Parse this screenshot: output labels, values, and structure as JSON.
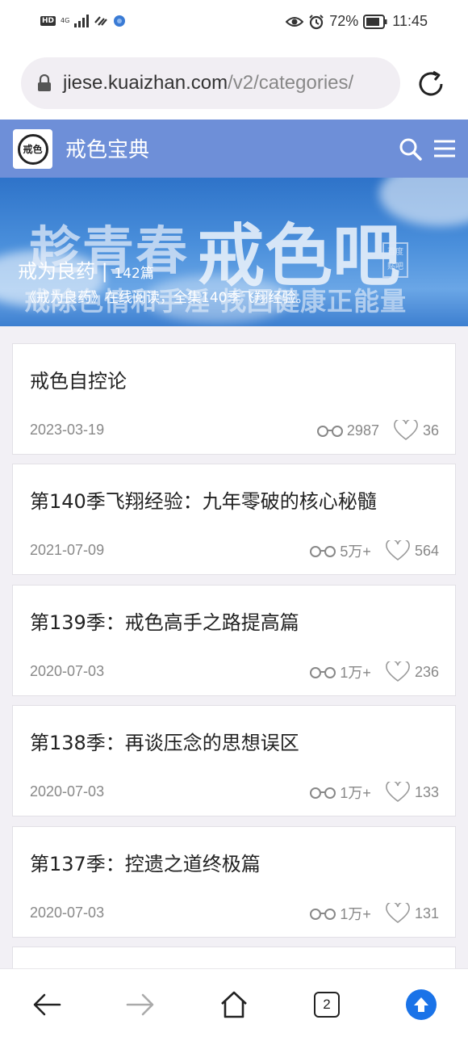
{
  "status_bar": {
    "hd": "HD",
    "network": "4G",
    "battery": "72%",
    "time": "11:45"
  },
  "address_bar": {
    "domain": "jiese.kuaizhan.com",
    "path": "/v2/categories/"
  },
  "site": {
    "title": "戒色宝典",
    "logo_text": "戒色"
  },
  "banner": {
    "image_text_1": "趁青春",
    "image_text_2": "戒色吧",
    "image_text_3": "戒除色情和手淫 找回健康正能量",
    "seal_text": "百度贴吧",
    "category_title": "戒为良药",
    "separator": "|",
    "count": "142篇",
    "description": "《戒为良药》在线阅读，全集140季飞翔经验。"
  },
  "articles": [
    {
      "title": "戒色自控论",
      "date": "2023-03-19",
      "views": "2987",
      "likes": "36"
    },
    {
      "title": "第140季飞翔经验：九年零破的核心秘髓",
      "date": "2021-07-09",
      "views": "5万+",
      "likes": "564"
    },
    {
      "title": "第139季：戒色高手之路提高篇",
      "date": "2020-07-03",
      "views": "1万+",
      "likes": "236"
    },
    {
      "title": "第138季：再谈压念的思想误区",
      "date": "2020-07-03",
      "views": "1万+",
      "likes": "133"
    },
    {
      "title": "第137季：控遗之道终极篇",
      "date": "2020-07-03",
      "views": "1万+",
      "likes": "131"
    }
  ],
  "bottom_nav": {
    "tab_count": "2"
  },
  "colors": {
    "header_bg": "#6e8fd8",
    "accent_blue": "#1a73e8",
    "page_bg": "#f2f0f5"
  },
  "icons": [
    "lock-icon",
    "reload-icon",
    "search-icon",
    "menu-icon",
    "views-icon",
    "heart-icon",
    "back-icon",
    "forward-icon",
    "home-icon",
    "tabs-icon",
    "upload-icon"
  ]
}
